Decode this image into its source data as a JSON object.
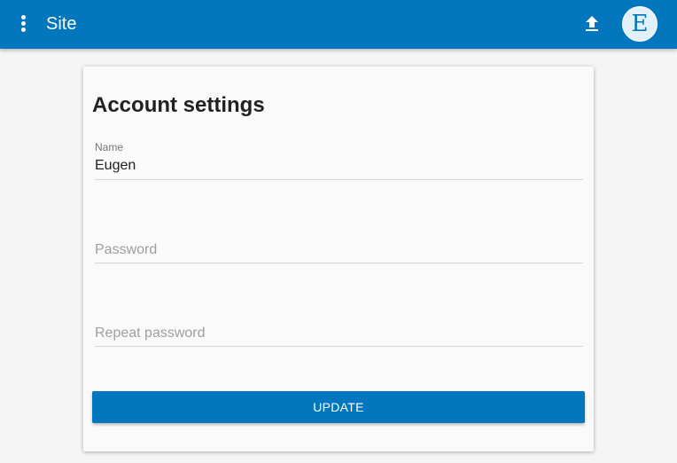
{
  "appbar": {
    "title": "Site",
    "menu_icon": "more-vert-icon",
    "upload_icon": "upload-icon",
    "avatar_letter": "E",
    "color": "#0277bd"
  },
  "form": {
    "title": "Account settings",
    "name_label": "Name",
    "name_value": "Eugen",
    "password_placeholder": "Password",
    "repeat_password_placeholder": "Repeat password",
    "update_label": "UPDATE"
  }
}
